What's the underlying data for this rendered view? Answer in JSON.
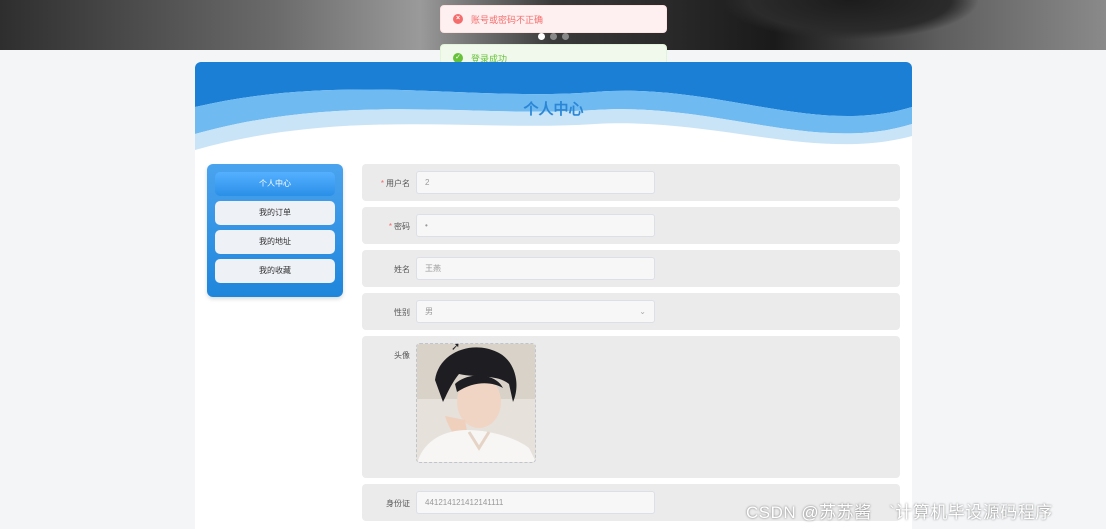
{
  "banner": {
    "dots": 3,
    "active_dot": 0
  },
  "toasts": [
    {
      "type": "error",
      "icon": "close-circle-icon",
      "text": "账号或密码不正确"
    },
    {
      "type": "success",
      "icon": "check-circle-icon",
      "text": "登录成功"
    }
  ],
  "page": {
    "title": "个人中心"
  },
  "sidebar": {
    "items": [
      {
        "label": "个人中心",
        "active": true
      },
      {
        "label": "我的订单",
        "active": false
      },
      {
        "label": "我的地址",
        "active": false
      },
      {
        "label": "我的收藏",
        "active": false
      }
    ]
  },
  "form": {
    "username": {
      "label": "用户名",
      "required": "*",
      "value": "2"
    },
    "password": {
      "label": "密码",
      "required": "*",
      "value": "•"
    },
    "name": {
      "label": "姓名",
      "value": "王燕"
    },
    "gender": {
      "label": "性别",
      "value": "男"
    },
    "avatar": {
      "label": "头像"
    },
    "idcard": {
      "label": "身份证",
      "value": "441214121412141111"
    }
  },
  "watermark": "CSDN @苏苏酱　`计算机毕设源码程序",
  "colors": {
    "accent": "#2b87d6",
    "error": "#f56c6c",
    "success": "#67c23a"
  }
}
